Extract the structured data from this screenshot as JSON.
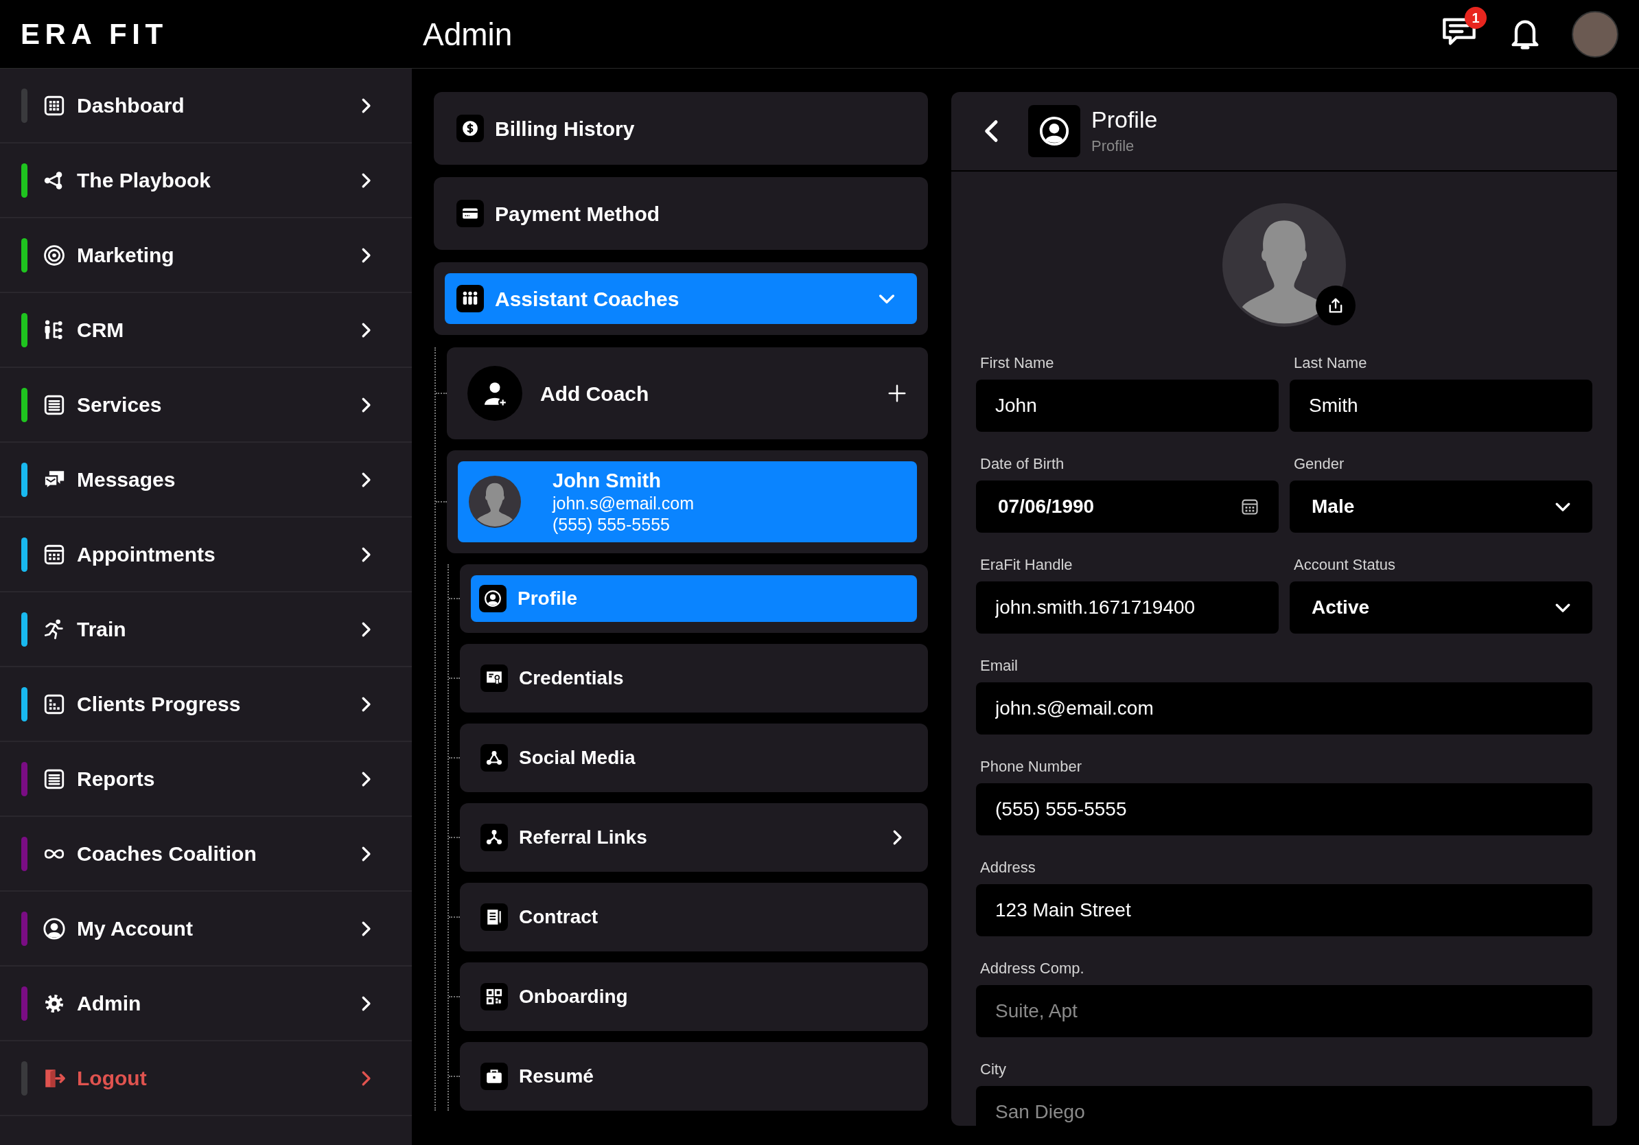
{
  "header": {
    "logo": "ERA FIT",
    "title": "Admin",
    "message_badge": "1"
  },
  "sidebar": {
    "items": [
      {
        "label": "Dashboard",
        "color": "#3a3a3d",
        "kind": "nav"
      },
      {
        "label": "The Playbook",
        "color": "#1fc41f",
        "kind": "nav"
      },
      {
        "label": "Marketing",
        "color": "#1fc41f",
        "kind": "nav"
      },
      {
        "label": "CRM",
        "color": "#1fc41f",
        "kind": "nav"
      },
      {
        "label": "Services",
        "color": "#1fc41f",
        "kind": "nav"
      },
      {
        "label": "Messages",
        "color": "#19b9ef",
        "kind": "nav"
      },
      {
        "label": "Appointments",
        "color": "#19b9ef",
        "kind": "nav"
      },
      {
        "label": "Train",
        "color": "#19b9ef",
        "kind": "nav"
      },
      {
        "label": "Clients Progress",
        "color": "#19b9ef",
        "kind": "nav"
      },
      {
        "label": "Reports",
        "color": "#7a0d84",
        "kind": "nav"
      },
      {
        "label": "Coaches Coalition",
        "color": "#7a0d84",
        "kind": "nav"
      },
      {
        "label": "My Account",
        "color": "#7a0d84",
        "kind": "nav"
      },
      {
        "label": "Admin",
        "color": "#7a0d84",
        "kind": "nav"
      },
      {
        "label": "Logout",
        "color": "#3a3a3d",
        "kind": "logout"
      }
    ]
  },
  "menu": {
    "items": [
      {
        "label": "Billing History"
      },
      {
        "label": "Payment Method"
      }
    ],
    "group": {
      "label": "Assistant Coaches",
      "expanded": true,
      "add_label": "Add Coach",
      "coaches": [
        {
          "name": "John Smith",
          "email": "john.s@email.com",
          "phone": "(555) 555-5555",
          "selected": true,
          "children": [
            {
              "label": "Profile",
              "selected": true,
              "kind": "page"
            },
            {
              "label": "Credentials",
              "selected": false,
              "kind": "page"
            },
            {
              "label": "Social Media",
              "selected": false,
              "kind": "page"
            },
            {
              "label": "Referral Links",
              "selected": false,
              "kind": "submenu"
            },
            {
              "label": "Contract",
              "selected": false,
              "kind": "page"
            },
            {
              "label": "Onboarding",
              "selected": false,
              "kind": "page"
            },
            {
              "label": "Resumé",
              "selected": false,
              "kind": "page"
            }
          ]
        }
      ]
    }
  },
  "profile": {
    "title": "Profile",
    "subtitle": "Profile",
    "rows": [
      [
        {
          "label": "First Name",
          "value": "John",
          "kind": "text"
        },
        {
          "label": "Last Name",
          "value": "Smith",
          "kind": "text"
        }
      ],
      [
        {
          "label": "Date of Birth",
          "value": "07/06/1990",
          "kind": "date"
        },
        {
          "label": "Gender",
          "value": "Male",
          "kind": "select"
        }
      ],
      [
        {
          "label": "EraFit Handle",
          "value": "john.smith.1671719400",
          "kind": "text"
        },
        {
          "label": "Account Status",
          "value": "Active",
          "kind": "select"
        }
      ],
      [
        {
          "label": "Email",
          "value": "john.s@email.com",
          "kind": "text"
        }
      ],
      [
        {
          "label": "Phone Number",
          "value": "(555) 555-5555",
          "kind": "text"
        }
      ],
      [
        {
          "label": "Address",
          "value": "123 Main Street",
          "kind": "text"
        }
      ],
      [
        {
          "label": "Address Comp.",
          "placeholder": "Suite, Apt",
          "kind": "text"
        }
      ],
      [
        {
          "label": "City",
          "placeholder": "San Diego",
          "kind": "text"
        }
      ]
    ]
  }
}
